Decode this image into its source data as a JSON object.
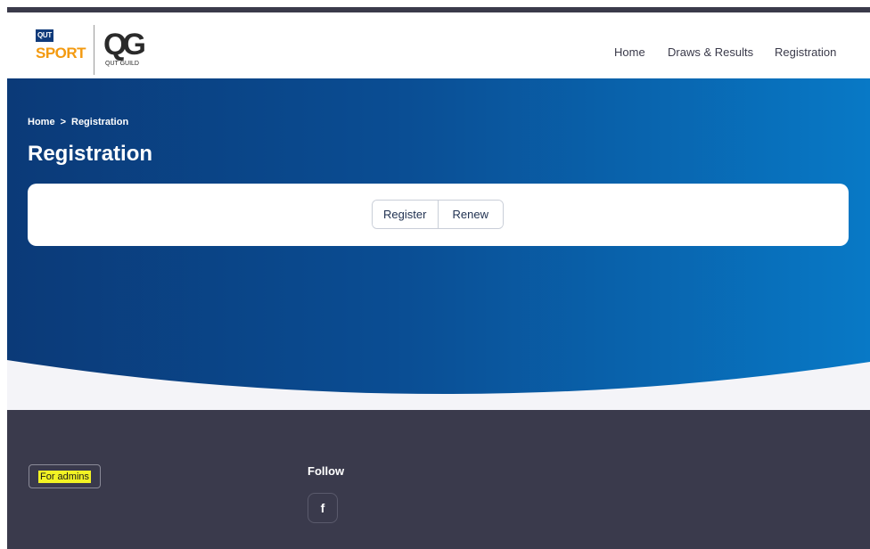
{
  "logo": {
    "qut_badge": "QUT",
    "sport": "SPORT",
    "guild_mark": "QG",
    "guild_text": "QUT GUILD"
  },
  "nav": {
    "items": [
      {
        "label": "Home"
      },
      {
        "label": "Draws & Results"
      },
      {
        "label": "Registration"
      }
    ]
  },
  "breadcrumb": {
    "home": "Home",
    "separator": ">",
    "current": "Registration"
  },
  "page": {
    "title": "Registration"
  },
  "registration_options": {
    "register_label": "Register",
    "renew_label": "Renew"
  },
  "footer": {
    "admins_label": "For admins",
    "follow_heading": "Follow",
    "facebook_glyph": "f"
  },
  "colors": {
    "brand_orange": "#f39a10",
    "hero_dark": "#0b3a78",
    "hero_light": "#0879c6",
    "footer_bg": "#3a3a4c",
    "highlight": "#f3f324"
  },
  "icons": [
    "facebook-icon",
    "chevron-right-icon"
  ]
}
